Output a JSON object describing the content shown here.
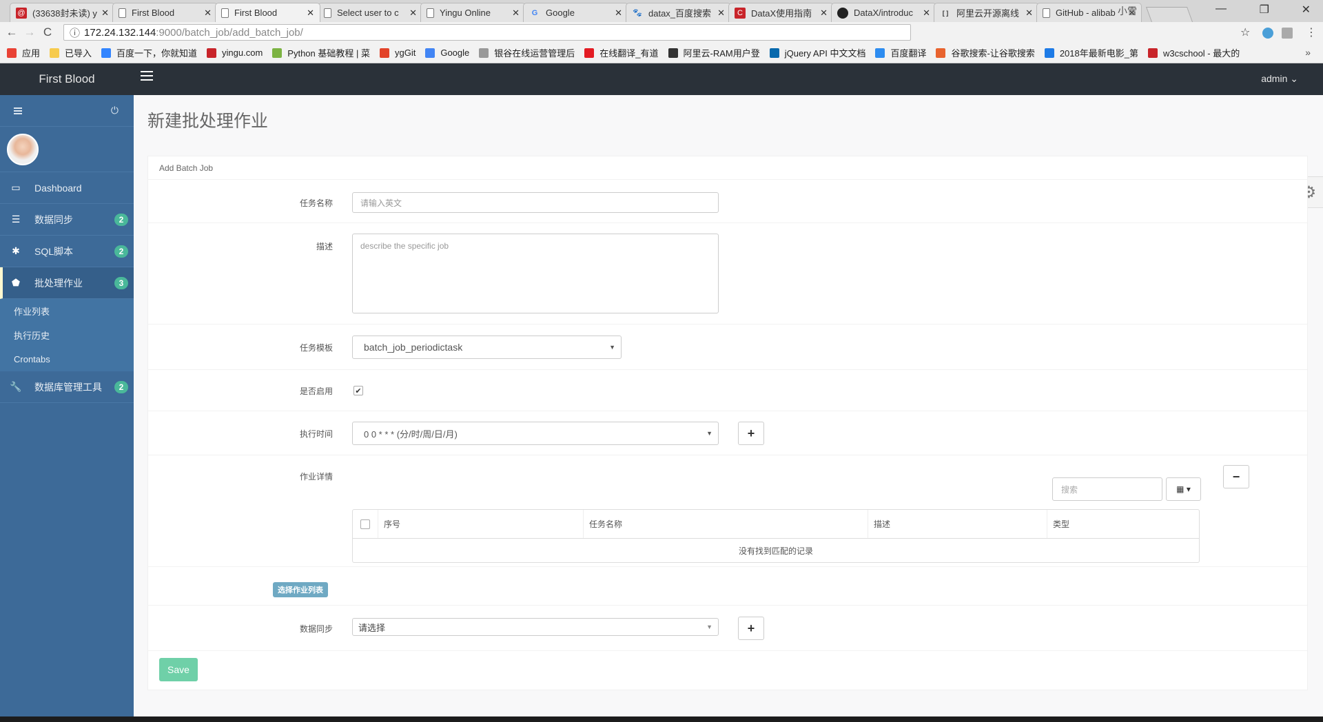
{
  "browser": {
    "tabs": [
      {
        "title": "(33638封未读) y",
        "icon": "mail-icon",
        "icon_color": "#c8242a",
        "active": false
      },
      {
        "title": "First Blood",
        "icon": "page-icon",
        "active": false
      },
      {
        "title": "First Blood",
        "icon": "page-icon",
        "active": true
      },
      {
        "title": "Select user to c",
        "icon": "page-icon",
        "active": false
      },
      {
        "title": "Yingu Online",
        "icon": "page-icon",
        "active": false
      },
      {
        "title": "Google",
        "icon": "google-icon",
        "active": false
      },
      {
        "title": "datax_百度搜索",
        "icon": "baidu-icon",
        "active": false
      },
      {
        "title": "DataX使用指南",
        "icon": "csdn-icon",
        "icon_color": "#c8242a",
        "active": false
      },
      {
        "title": "DataX/introduc",
        "icon": "github-icon",
        "active": false
      },
      {
        "title": "阿里云开源离线",
        "icon": "aliyun-icon",
        "active": false
      },
      {
        "title": "GitHub - alibab",
        "icon": "page-icon",
        "active": false
      }
    ],
    "tab_close_glyph": "✕",
    "window_user": "小雪",
    "window_controls": {
      "minimize": "—",
      "restore": "❐",
      "close": "✕"
    },
    "address": {
      "host": "172.24.132.144",
      "path": ":9000/batch_job/add_batch_job/"
    },
    "nav": {
      "back": "←",
      "forward": "→",
      "reload": "C",
      "info": "ⓘ",
      "star": "☆",
      "menu": "⋮"
    },
    "bookmarks": [
      {
        "label": "应用",
        "icon": "apps-icon",
        "color": "#e94235"
      },
      {
        "label": "已导入",
        "icon": "folder-icon",
        "color": "#f7cb4d"
      },
      {
        "label": "百度一下，你就知道",
        "icon": "baidu-icon",
        "color": "#3385ff"
      },
      {
        "label": "yingu.com",
        "icon": "mail-icon",
        "color": "#c8242a"
      },
      {
        "label": "Python 基础教程 | 菜",
        "icon": "runoob-icon",
        "color": "#7cb342"
      },
      {
        "label": "ygGit",
        "icon": "gitlab-icon",
        "color": "#e24329"
      },
      {
        "label": "Google",
        "icon": "google-icon",
        "color": "#4285f4"
      },
      {
        "label": "银谷在线运营管理后",
        "icon": "page-icon",
        "color": "#999999"
      },
      {
        "label": "在线翻译_有道",
        "icon": "youdao-icon",
        "color": "#e31b23"
      },
      {
        "label": "阿里云-RAM用户登",
        "icon": "aliyun-icon",
        "color": "#333333"
      },
      {
        "label": "jQuery API 中文文档",
        "icon": "jquery-icon",
        "color": "#0769ad"
      },
      {
        "label": "百度翻译",
        "icon": "translate-icon",
        "color": "#2d8cf0"
      },
      {
        "label": "谷歌搜索-让谷歌搜索",
        "icon": "flame-icon",
        "color": "#e8632e"
      },
      {
        "label": "2018年最新电影_第",
        "icon": "bt-icon",
        "color": "#1e7be6"
      },
      {
        "label": "w3cschool - 最大的",
        "icon": "w3c-icon",
        "color": "#c8242a"
      }
    ],
    "bookmarks_more": "»"
  },
  "app": {
    "brand": "First Blood",
    "user_menu": "admin ⌄",
    "sidebar": {
      "items": [
        {
          "label": "Dashboard",
          "icon": "monitor-icon",
          "glyph": "▭",
          "badge": null
        },
        {
          "label": "数据同步",
          "icon": "list-icon",
          "glyph": "☰",
          "badge": "2"
        },
        {
          "label": "SQL脚本",
          "icon": "asterisk-icon",
          "glyph": "✱",
          "badge": "2"
        },
        {
          "label": "批处理作业",
          "icon": "tag-icon",
          "glyph": "⬟",
          "badge": "3",
          "active": true
        },
        {
          "label": "数据库管理工具",
          "icon": "wrench-icon",
          "glyph": "🔧",
          "badge": "2"
        }
      ],
      "subitems": [
        "作业列表",
        "执行历史",
        "Crontabs"
      ],
      "power_glyph": "⏻"
    },
    "page_title": "新建批处理作业",
    "panel_title": "Add Batch Job",
    "form": {
      "name_label": "任务名称",
      "name_placeholder": "请输入英文",
      "desc_label": "描述",
      "desc_placeholder": "describe the specific job",
      "template_label": "任务模板",
      "template_value": "batch_job_periodictask",
      "enabled_label": "是否启用",
      "enabled": true,
      "schedule_label": "执行时间",
      "schedule_value": "0 0 * * * (分/时/周/日/月)",
      "details_label": "作业详情",
      "search_placeholder": "搜索",
      "table": {
        "columns": [
          "序号",
          "任务名称",
          "描述",
          "类型"
        ],
        "empty_text": "没有找到匹配的记录"
      },
      "select_jobs_tag": "选择作业列表",
      "sync_label": "数据同步",
      "sync_value": "请选择",
      "save_label": "Save"
    },
    "glyphs": {
      "plus": "+",
      "minus": "−",
      "caret": "▼",
      "check": "✔",
      "gear": "⚙",
      "grid": "▦ ▾"
    }
  }
}
